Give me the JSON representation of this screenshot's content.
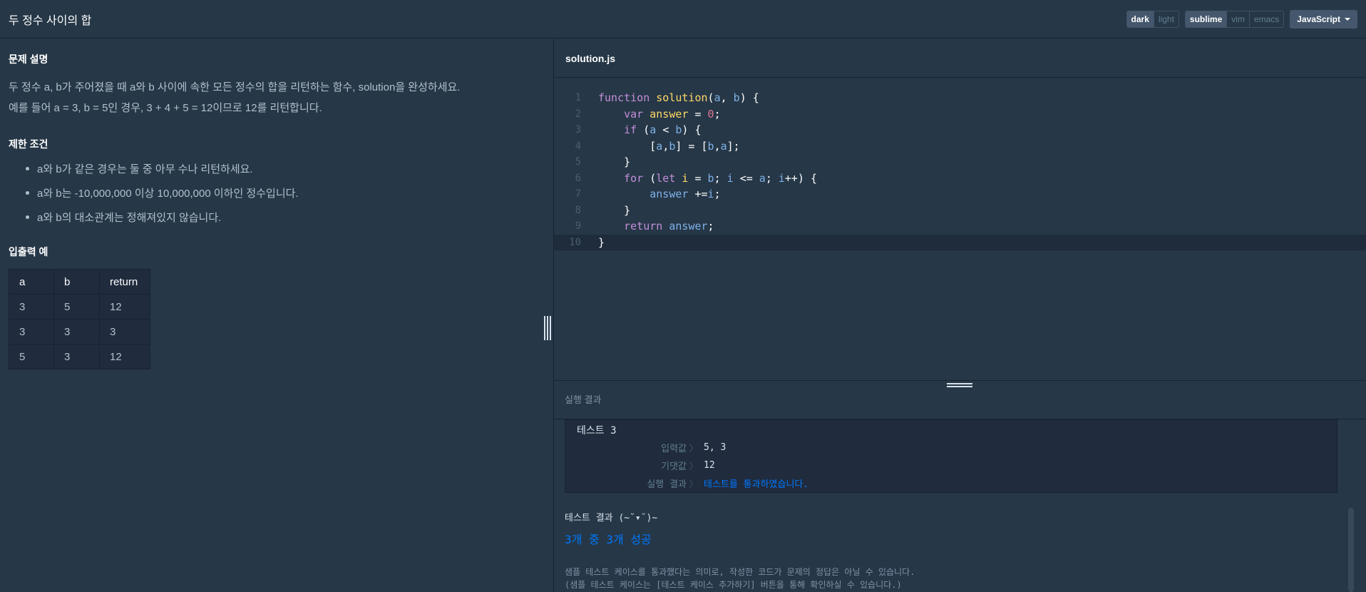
{
  "header": {
    "title": "두 정수 사이의 합",
    "theme_options": [
      "dark",
      "light"
    ],
    "keymap_options": [
      "sublime",
      "vim",
      "emacs"
    ],
    "language": "JavaScript"
  },
  "problem": {
    "desc_title": "문제 설명",
    "desc_lines": [
      "두 정수 a, b가 주어졌을 때 a와 b 사이에 속한 모든 정수의 합을 리턴하는 함수, solution을 완성하세요.",
      "예를 들어 a = 3, b = 5인 경우, 3 + 4 + 5 = 12이므로 12를 리턴합니다."
    ],
    "constraints_title": "제한 조건",
    "constraints": [
      "a와 b가 같은 경우는 둘 중 아무 수나 리턴하세요.",
      "a와 b는 -10,000,000 이상 10,000,000 이하인 정수입니다.",
      "a와 b의 대소관계는 정해져있지 않습니다."
    ],
    "io_title": "입출력 예",
    "io_headers": [
      "a",
      "b",
      "return"
    ],
    "io_rows": [
      [
        "3",
        "5",
        "12"
      ],
      [
        "3",
        "3",
        "3"
      ],
      [
        "5",
        "3",
        "12"
      ]
    ]
  },
  "editor": {
    "filename": "solution.js",
    "line_numbers": [
      "1",
      "2",
      "3",
      "4",
      "5",
      "6",
      "7",
      "8",
      "9",
      "10"
    ],
    "active_line": 10
  },
  "result": {
    "title": "실행 결과",
    "case_label": "테스트 3",
    "input_key": "입력값",
    "input_val": "5, 3",
    "expected_key": "기댓값",
    "expected_val": "12",
    "run_key": "실행 결과",
    "run_val": "테스트를 통과하였습니다.",
    "separator": "〉",
    "summary_title": "테스트 결과 (~˘▾˘)~",
    "summary": "3개 중 3개 성공",
    "note_1": "샘플 테스트 케이스를 통과했다는 의미로, 작성한 코드가 문제의 정답은 아닐 수 있습니다.",
    "note_2": "(샘플 테스트 케이스는 [테스트 케이스 추가하기] 버튼을 통해 확인하실 수 있습니다.)"
  },
  "colors": {
    "background": "#263747",
    "accent_blue": "#0078ff",
    "keyword": "#c38fd9",
    "function": "#ffd866",
    "variable": "#7fb1e8",
    "number": "#e27891"
  }
}
